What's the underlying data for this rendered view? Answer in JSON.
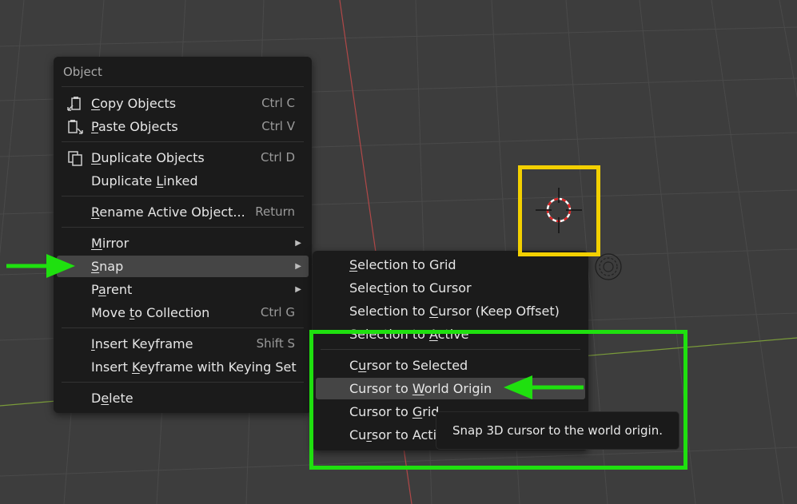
{
  "menu": {
    "title": "Object",
    "items": [
      {
        "label": "Copy Objects",
        "shortcut": "Ctrl C",
        "icon": "copy-icon"
      },
      {
        "label": "Paste Objects",
        "shortcut": "Ctrl V",
        "icon": "paste-icon"
      },
      {
        "label": "Duplicate Objects",
        "shortcut": "Ctrl D",
        "icon": "duplicate-icon"
      },
      {
        "label": "Duplicate Linked",
        "shortcut": ""
      },
      {
        "label": "Rename Active Object...",
        "shortcut": "Return"
      },
      {
        "label": "Mirror",
        "shortcut": "",
        "submenu": true
      },
      {
        "label": "Snap",
        "shortcut": "",
        "submenu": true,
        "active": true
      },
      {
        "label": "Parent",
        "shortcut": "",
        "submenu": true
      },
      {
        "label": "Move to Collection",
        "shortcut": "Ctrl G"
      },
      {
        "label": "Insert Keyframe",
        "shortcut": "Shift S"
      },
      {
        "label": "Insert Keyframe with Keying Set",
        "shortcut": ""
      },
      {
        "label": "Delete",
        "shortcut": ""
      }
    ]
  },
  "snap_menu": {
    "items": [
      {
        "label": "Selection to Grid"
      },
      {
        "label": "Selection to Cursor"
      },
      {
        "label": "Selection to Cursor (Keep Offset)"
      },
      {
        "label": "Selection to Active"
      },
      {
        "label": "Cursor to Selected"
      },
      {
        "label": "Cursor to World Origin",
        "active": true
      },
      {
        "label": "Cursor to Grid"
      },
      {
        "label": "Cursor to Active"
      }
    ]
  },
  "tooltip": {
    "text": "Snap 3D cursor to the world origin."
  },
  "colors": {
    "viewport_bg": "#3d3d3d",
    "grid_line": "#4a4a4a",
    "x_axis": "#b04848",
    "y_axis": "#7a9b3a",
    "annotation_yellow": "#f3d000",
    "annotation_green": "#1fe00f"
  }
}
